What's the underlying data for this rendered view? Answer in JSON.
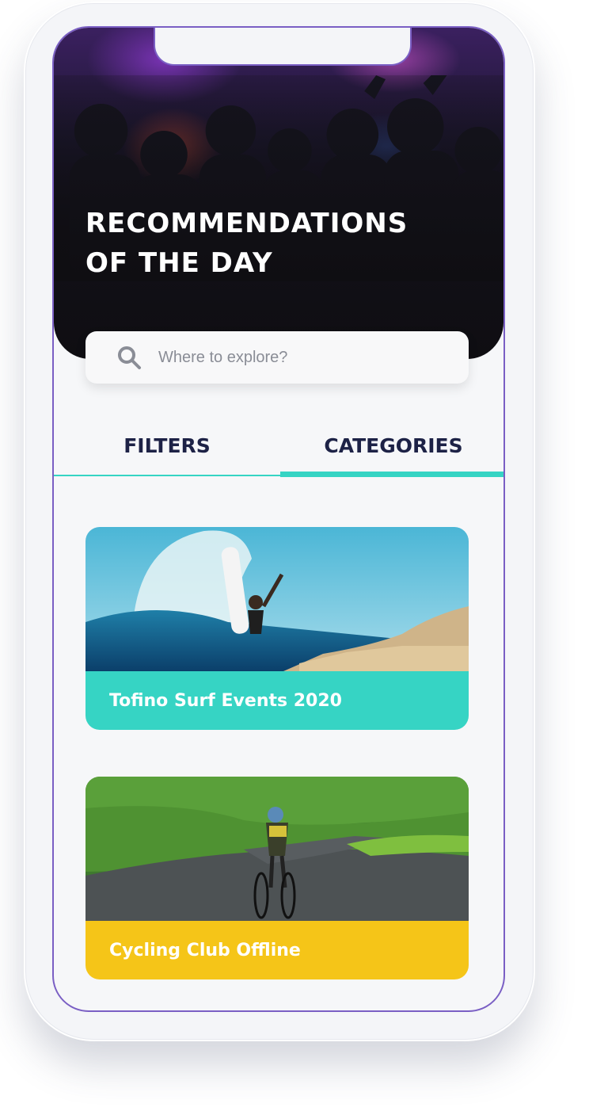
{
  "hero": {
    "title_line1": "RECOMMENDATIONS",
    "title_line2": "OF THE DAY"
  },
  "search": {
    "placeholder": "Where to explore?",
    "icon": "search-icon"
  },
  "tabs": [
    {
      "label": "FILTERS",
      "active": false
    },
    {
      "label": "CATEGORIES",
      "active": true
    }
  ],
  "cards": [
    {
      "label": "Tofino Surf Events 2020",
      "color": "#36d4c4"
    },
    {
      "label": "Cycling Club Offline",
      "color": "#f5c518"
    }
  ],
  "colors": {
    "accent": "#36d4c4",
    "tab_text": "#1d2246",
    "frame": "#7a5fc4"
  }
}
